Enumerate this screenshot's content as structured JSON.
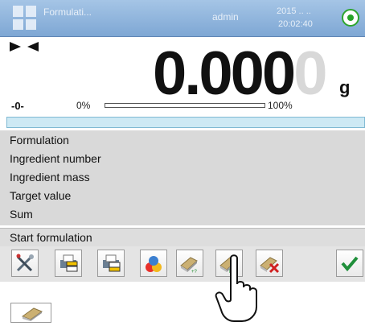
{
  "header": {
    "title": "Formulati...",
    "user": "admin",
    "date": "2015 .. ..",
    "time": "20:02:40"
  },
  "reading": {
    "value": "0.000",
    "dim_digit": "0",
    "unit": "g",
    "zero_indicator": "-0-",
    "bar_min": "0%",
    "bar_max": "100%",
    "bar_level": 0
  },
  "info": {
    "rows": [
      "Formulation",
      "Ingredient number",
      "Ingredient mass",
      "Target value",
      "Sum"
    ]
  },
  "start_label": "Start formulation",
  "toolbar": {
    "buttons": [
      {
        "icon": "tools-icon"
      },
      {
        "icon": "print-header-icon"
      },
      {
        "icon": "print-footer-icon"
      },
      {
        "icon": "formulation-icon"
      },
      {
        "icon": "ingredient-number-icon"
      },
      {
        "icon": "ingredient-mass-icon"
      },
      {
        "icon": "ingredient-delete-icon"
      },
      {
        "icon": "confirm-icon"
      }
    ]
  },
  "colors": {
    "header": "#7ea7d4",
    "status": "#27a327",
    "confirm": "#1f8f3a"
  }
}
